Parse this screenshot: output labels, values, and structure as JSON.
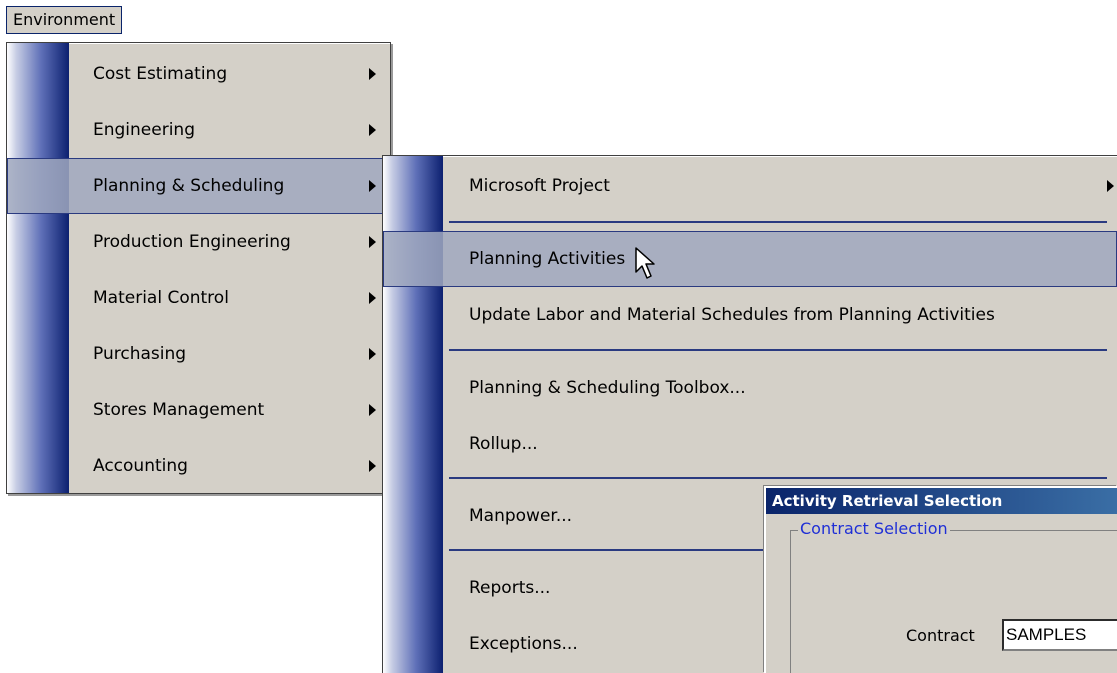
{
  "menubar": {
    "environment_label": "Environment"
  },
  "environment_menu": {
    "items": [
      {
        "label": "Cost Estimating",
        "has_submenu": true
      },
      {
        "label": "Engineering",
        "has_submenu": true
      },
      {
        "label": "Planning & Scheduling",
        "has_submenu": true,
        "highlighted": true
      },
      {
        "label": "Production Engineering",
        "has_submenu": true
      },
      {
        "label": "Material Control",
        "has_submenu": true
      },
      {
        "label": "Purchasing",
        "has_submenu": true
      },
      {
        "label": "Stores Management",
        "has_submenu": true
      },
      {
        "label": "Accounting",
        "has_submenu": true
      }
    ]
  },
  "planning_submenu": {
    "items": [
      {
        "label": "Microsoft Project",
        "has_submenu": true
      },
      {
        "label": "Planning Activities",
        "highlighted": true
      },
      {
        "label": "Update Labor and Material Schedules from Planning Activities"
      },
      {
        "label": "Planning & Scheduling Toolbox..."
      },
      {
        "label": "Rollup..."
      },
      {
        "label": "Manpower..."
      },
      {
        "label": "Reports..."
      },
      {
        "label": "Exceptions..."
      }
    ]
  },
  "dialog": {
    "title": "Activity Retrieval Selection",
    "group_title": "Contract Selection",
    "contract_label": "Contract",
    "contract_value": "SAMPLES"
  },
  "colors": {
    "menu_background": "#d4d0c8",
    "highlight": "#a0a8be",
    "separator": "#2a3a80",
    "titlebar": "#0a246a",
    "group_title": "#1f2fd6"
  }
}
